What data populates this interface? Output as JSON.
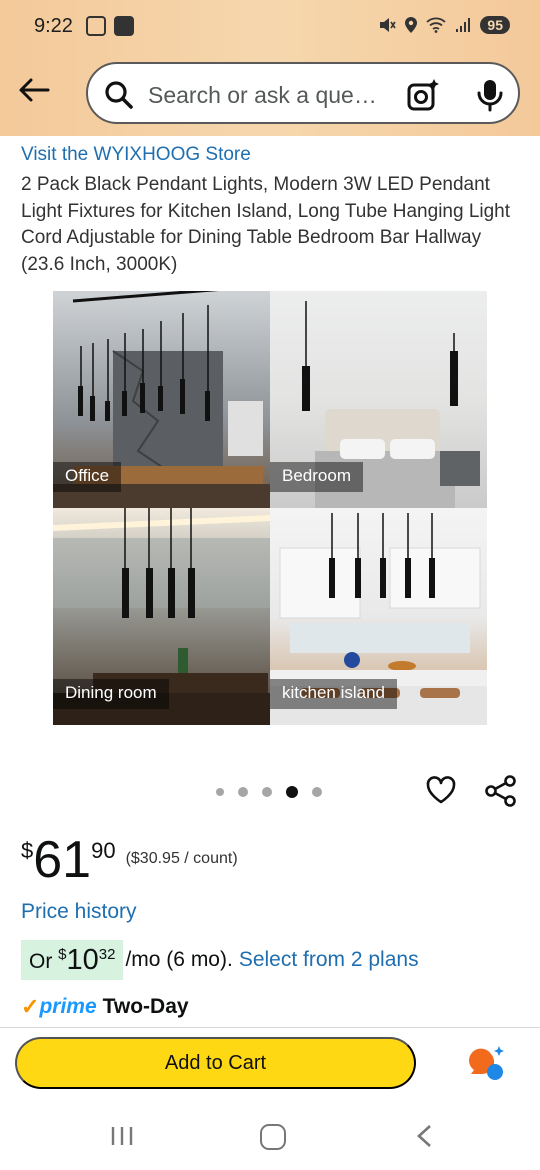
{
  "status_bar": {
    "time": "9:22",
    "battery": "95"
  },
  "search": {
    "placeholder": "Search or ask a question"
  },
  "product": {
    "store_link": "Visit the WYIXHOOG Store",
    "title": "2 Pack Black Pendant Lights, Modern 3W LED Pendant Light Fixtures for Kitchen Island, Long Tube Hanging Light Cord Adjustable for Dining Table Bedroom Bar Hallway (23.6 Inch, 3000K)",
    "gallery": [
      {
        "caption": "Office"
      },
      {
        "caption": "Bedroom"
      },
      {
        "caption": "Dining room"
      },
      {
        "caption": "kitchen island"
      }
    ],
    "carousel": {
      "total": 5,
      "active_index": 3
    },
    "price": {
      "symbol": "$",
      "whole": "61",
      "fraction": "90",
      "unit_price": "($30.95 / count)"
    },
    "price_history": "Price history",
    "installment": {
      "prefix": "Or ",
      "symbol": "$",
      "whole": "10",
      "fraction": "32",
      "suffix": "/mo (6 mo).",
      "plans_link": "Select from 2 plans"
    },
    "prime": {
      "check": "✓",
      "word": "prime",
      "delivery": "Two-Day"
    }
  },
  "actions": {
    "add_to_cart": "Add to Cart"
  },
  "colors": {
    "header_bg": "#f6d7ad",
    "link": "#1f6fb0",
    "cart_button": "#ffd814",
    "installment_chip": "#d8f2e0",
    "prime_blue": "#1a98ff",
    "prime_check": "#f79400"
  }
}
